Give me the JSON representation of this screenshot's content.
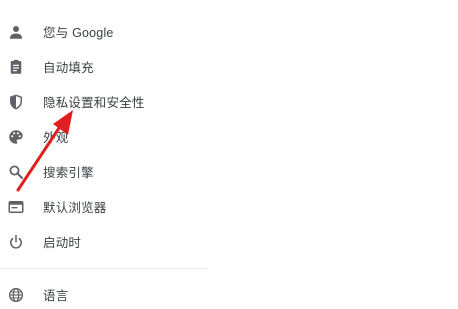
{
  "menu": {
    "items": [
      {
        "label": "您与 Google",
        "icon": "person-icon"
      },
      {
        "label": "自动填充",
        "icon": "clipboard-icon"
      },
      {
        "label": "隐私设置和安全性",
        "icon": "shield-icon"
      },
      {
        "label": "外观",
        "icon": "palette-icon"
      },
      {
        "label": "搜索引擎",
        "icon": "search-icon"
      },
      {
        "label": "默认浏览器",
        "icon": "browser-window-icon"
      },
      {
        "label": "启动时",
        "icon": "power-icon"
      }
    ],
    "language": {
      "label": "语言",
      "icon": "globe-icon"
    }
  },
  "colors": {
    "icon": "#5f6368",
    "text": "#3c4043",
    "divider": "#e8eaed",
    "annotation_arrow": "#e02020"
  },
  "annotation": {
    "type": "red-arrow",
    "points_to": "隐私设置和安全性"
  }
}
